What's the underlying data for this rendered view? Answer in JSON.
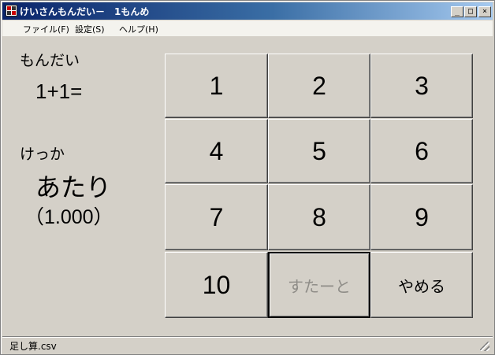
{
  "window": {
    "title": "けいさんもんだい－　1もんめ",
    "controls": {
      "minimize": "_",
      "maximize": "□",
      "close": "×"
    }
  },
  "menu": [
    "ファイル(F)",
    "設定(S)",
    "ヘルプ(H)"
  ],
  "question": {
    "label": "もんだい",
    "text": "1+1="
  },
  "result": {
    "label": "けっか",
    "text": "あたり",
    "score": "（1.000）"
  },
  "buttons": {
    "numbers": [
      "1",
      "2",
      "3",
      "4",
      "5",
      "6",
      "7",
      "8",
      "9",
      "10"
    ],
    "start": "すたーと",
    "quit": "やめる"
  },
  "status": {
    "file": "足し算.csv"
  },
  "colors": {
    "face": "#d4d0c8",
    "title_start": "#0a246a",
    "title_end": "#a6caf0",
    "disabled_text": "#8f8d88"
  }
}
